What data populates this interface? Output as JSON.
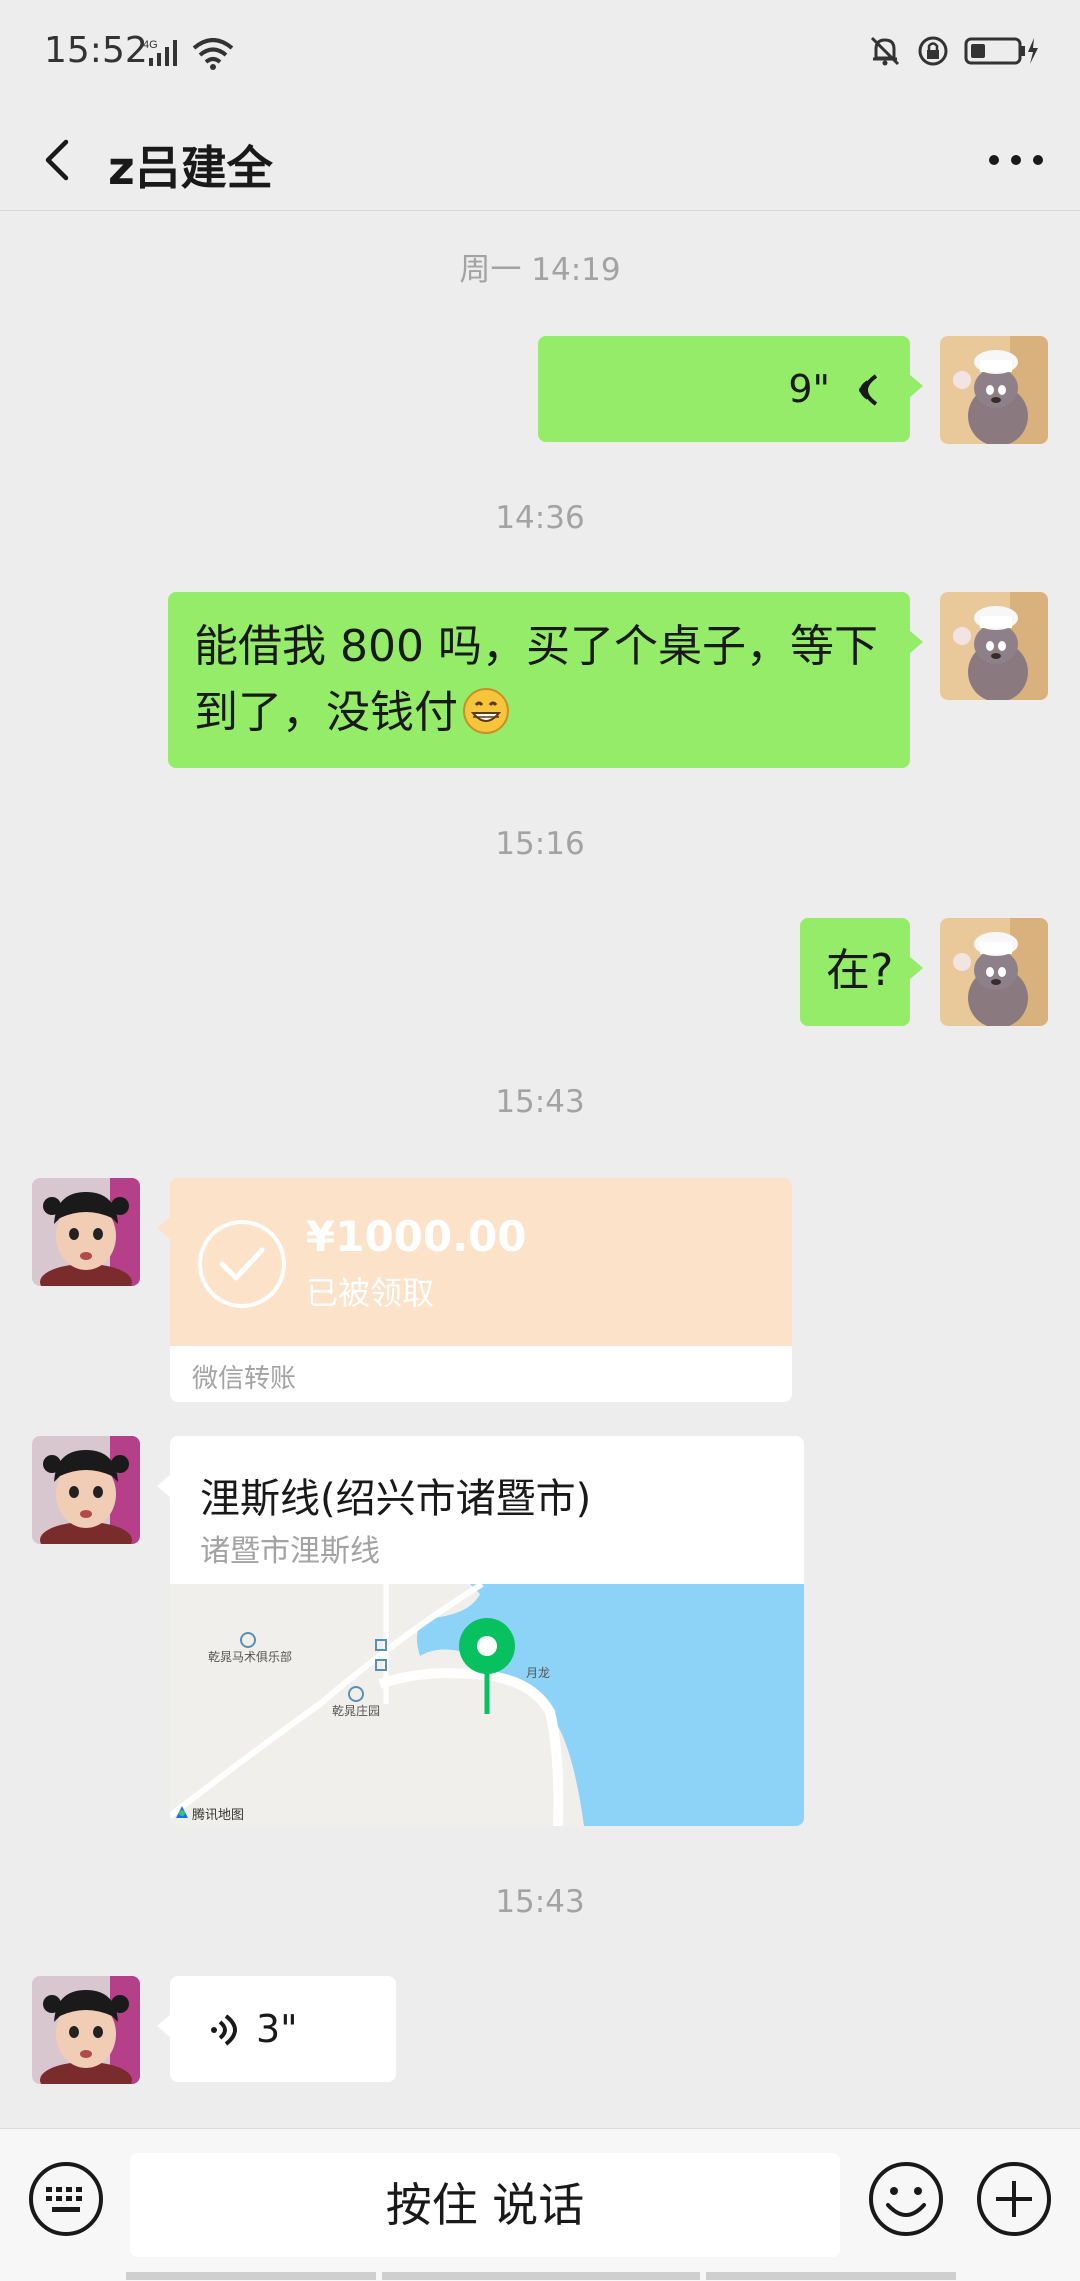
{
  "status_bar": {
    "time": "15:52",
    "network": "4G",
    "icons": [
      "signal-icon",
      "wifi-icon",
      "mute-bell-icon",
      "lock-rotation-icon",
      "battery-charging-icon"
    ]
  },
  "header": {
    "title": "z吕建全",
    "back_icon": "chevron-left-icon",
    "more_icon": "more-dots-icon"
  },
  "messages": [
    {
      "type": "timestamp",
      "text": "周一 14:19"
    },
    {
      "type": "voice",
      "direction": "out",
      "duration": "9\""
    },
    {
      "type": "timestamp",
      "text": "14:36"
    },
    {
      "type": "text",
      "direction": "out",
      "text": "能借我 800 吗，买了个桌子，等下到了，没钱付",
      "emoji": "grinning-face-emoji"
    },
    {
      "type": "timestamp",
      "text": "15:16"
    },
    {
      "type": "text",
      "direction": "out",
      "text": "在?"
    },
    {
      "type": "timestamp",
      "text": "15:43"
    },
    {
      "type": "transfer",
      "direction": "in",
      "amount": "¥1000.00",
      "status": "已被领取",
      "footer": "微信转账"
    },
    {
      "type": "location",
      "direction": "in",
      "title": "浬斯线(绍兴市诸暨市)",
      "subtitle": "诸暨市浬斯线",
      "map_labels": [
        "乾晁马术俱乐部",
        "乾晁庄园",
        "月龙"
      ],
      "map_brand": "腾讯地图"
    },
    {
      "type": "timestamp",
      "text": "15:43"
    },
    {
      "type": "voice",
      "direction": "in",
      "duration": "3\""
    }
  ],
  "input_bar": {
    "hold_to_talk": "按住 说话",
    "left_icon": "keyboard-icon",
    "emoji_icon": "smiley-icon",
    "plus_icon": "plus-circle-icon"
  },
  "colors": {
    "background": "#ededed",
    "sent_bubble": "#95ec69",
    "received_bubble": "#ffffff",
    "transfer_received": "#fbe2c8",
    "map_water": "#8dd3f7",
    "map_pin": "#07c160"
  }
}
